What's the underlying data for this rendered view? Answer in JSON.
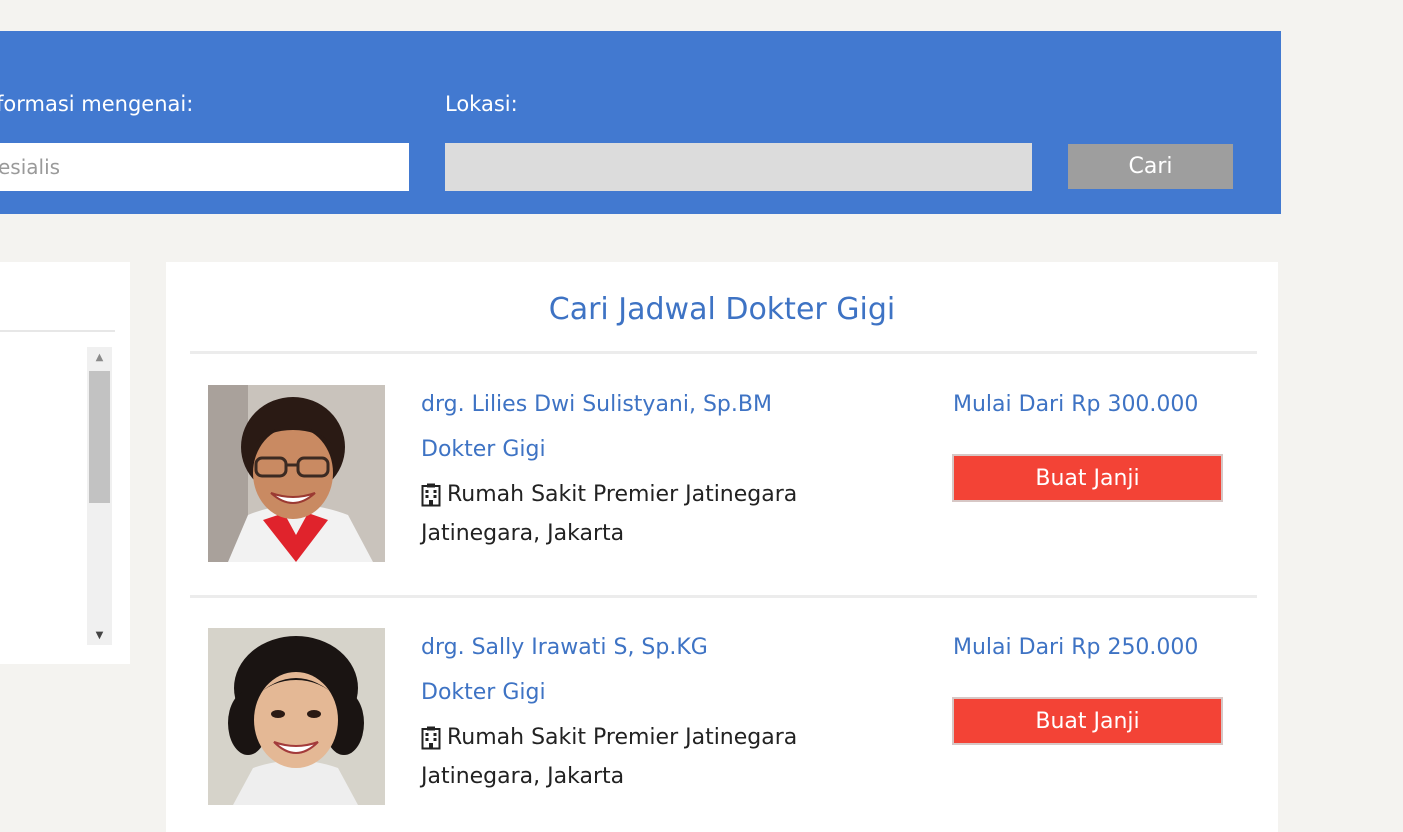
{
  "search": {
    "topic_label": "formasi mengenai:",
    "topic_placeholder": "esialis",
    "location_label": "Lokasi:",
    "location_value": "",
    "search_button": "Cari"
  },
  "results": {
    "title": "Cari Jadwal Dokter Gigi",
    "doctors": [
      {
        "name": "drg. Lilies Dwi Sulistyani, Sp.BM",
        "specialty": "Dokter Gigi",
        "hospital": "Rumah Sakit Premier Jatinegara",
        "city": "Jatinegara, Jakarta",
        "price": "Mulai Dari Rp 300.000",
        "book_button": "Buat Janji"
      },
      {
        "name": "drg. Sally Irawati S, Sp.KG",
        "specialty": "Dokter Gigi",
        "hospital": "Rumah Sakit Premier Jatinegara",
        "city": "Jatinegara, Jakarta",
        "price": "Mulai Dari Rp 250.000",
        "book_button": "Buat Janji"
      }
    ]
  },
  "icons": {
    "hospital": "hospital-icon",
    "scroll_up": "scroll-up-arrow-icon",
    "scroll_down": "scroll-down-arrow-icon"
  },
  "colors": {
    "banner": "#4279d0",
    "accent_text": "#3e73c4",
    "book_button": "#f34336",
    "search_button": "#9e9e9e"
  }
}
